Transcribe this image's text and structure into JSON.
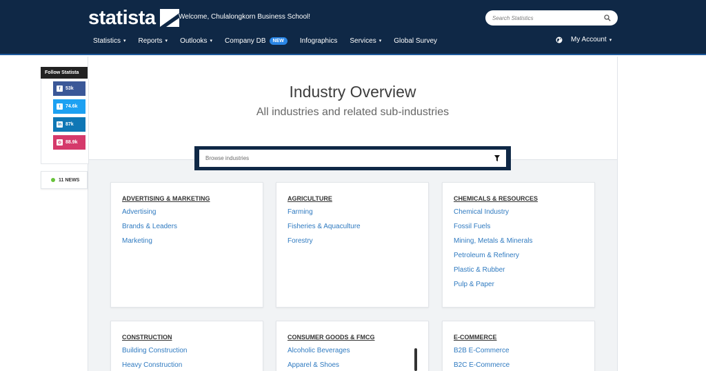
{
  "header": {
    "logo": "statista",
    "welcome": "Welcome, Chulalongkorn Business School!",
    "search_placeholder": "Search Statistics",
    "nav": [
      {
        "label": "Statistics",
        "caret": "▾"
      },
      {
        "label": "Reports",
        "caret": "▾"
      },
      {
        "label": "Outlooks",
        "caret": "▾"
      },
      {
        "label": "Company DB",
        "badge": "NEW"
      },
      {
        "label": "Infographics"
      },
      {
        "label": "Services",
        "caret": "▾"
      },
      {
        "label": "Global Survey"
      }
    ],
    "account": "My Account",
    "account_caret": "▾"
  },
  "hero": {
    "title": "Industry Overview",
    "subtitle": "All industries and related sub-industries"
  },
  "browse": {
    "placeholder": "Browse industries"
  },
  "follow": {
    "label": "Follow Statista",
    "socials": [
      {
        "network": "facebook",
        "icon": "f",
        "count": "53k"
      },
      {
        "network": "twitter",
        "icon": "t",
        "count": "74.6k"
      },
      {
        "network": "linkedin",
        "icon": "in",
        "count": "87k"
      },
      {
        "network": "instagram",
        "icon": "◎",
        "count": "88.9k"
      }
    ]
  },
  "news": {
    "label": "11 NEWS"
  },
  "cards": [
    {
      "title": "ADVERTISING & MARKETING",
      "links": [
        "Advertising",
        "Brands & Leaders",
        "Marketing"
      ]
    },
    {
      "title": "AGRICULTURE",
      "links": [
        "Farming",
        "Fisheries & Aquaculture",
        "Forestry"
      ]
    },
    {
      "title": "CHEMICALS & RESOURCES",
      "links": [
        "Chemical Industry",
        "Fossil Fuels",
        "Mining, Metals & Minerals",
        "Petroleum & Refinery",
        "Plastic & Rubber",
        "Pulp & Paper"
      ]
    },
    {
      "title": "CONSTRUCTION",
      "links": [
        "Building Construction",
        "Heavy Construction"
      ]
    },
    {
      "title": "CONSUMER GOODS & FMCG",
      "links": [
        "Alcoholic Beverages",
        "Apparel & Shoes"
      ]
    },
    {
      "title": "E-COMMERCE",
      "links": [
        "B2B E-Commerce",
        "B2C E-Commerce"
      ]
    }
  ],
  "colors": {
    "header_bg": "#0f2846",
    "link": "#2f7ac0",
    "new_badge": "#2a86e6"
  }
}
